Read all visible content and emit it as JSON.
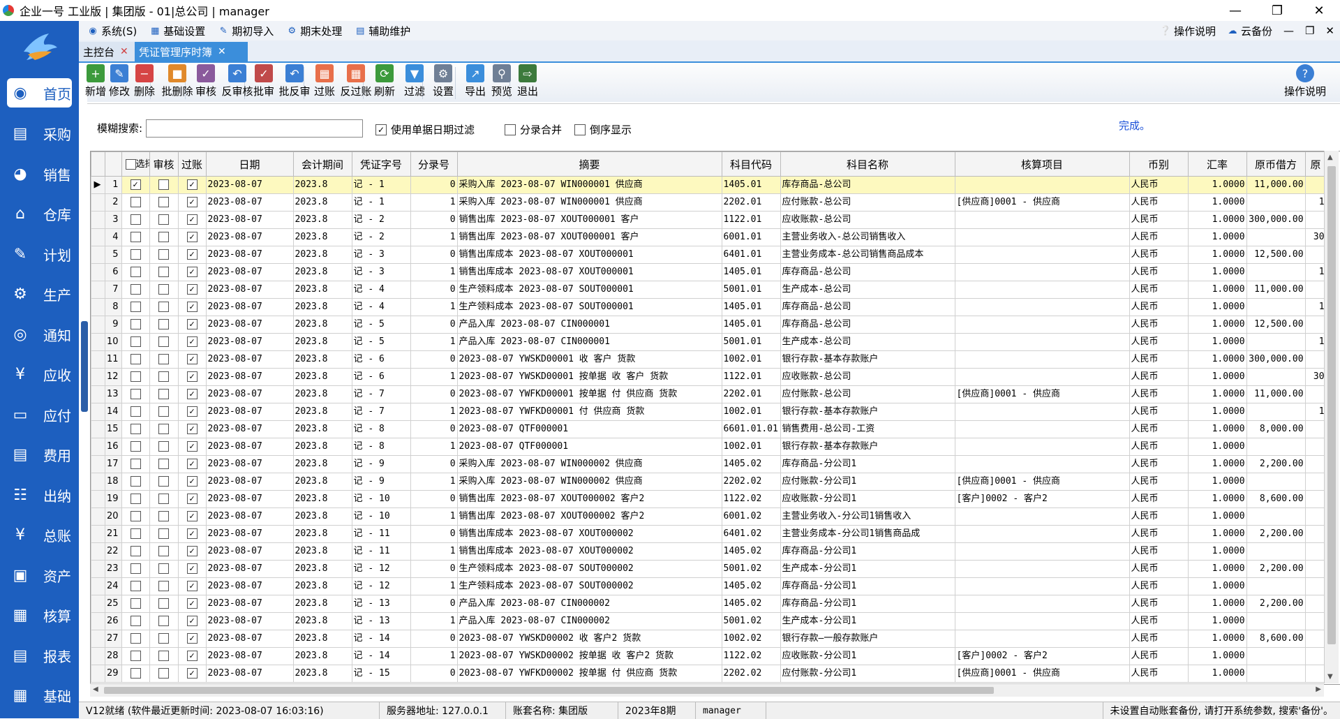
{
  "window": {
    "title": "企业一号 工业版 | 集团版 - 01|总公司 | manager"
  },
  "sidebar": {
    "items": [
      {
        "label": "首页",
        "icon": "compass-icon"
      },
      {
        "label": "采购",
        "icon": "purchase-icon"
      },
      {
        "label": "销售",
        "icon": "sales-chart-icon"
      },
      {
        "label": "仓库",
        "icon": "warehouse-icon"
      },
      {
        "label": "计划",
        "icon": "plan-icon"
      },
      {
        "label": "生产",
        "icon": "production-icon"
      },
      {
        "label": "通知",
        "icon": "notice-icon"
      },
      {
        "label": "应收",
        "icon": "receivable-icon"
      },
      {
        "label": "应付",
        "icon": "payable-icon"
      },
      {
        "label": "费用",
        "icon": "expense-icon"
      },
      {
        "label": "出纳",
        "icon": "cashier-icon"
      },
      {
        "label": "总账",
        "icon": "ledger-icon"
      },
      {
        "label": "资产",
        "icon": "asset-icon"
      },
      {
        "label": "核算",
        "icon": "accounting-icon"
      },
      {
        "label": "报表",
        "icon": "report-icon"
      },
      {
        "label": "基础",
        "icon": "basic-grid-icon"
      }
    ]
  },
  "menubar": {
    "items": [
      "系统(S)",
      "基础设置",
      "期初导入",
      "期末处理",
      "辅助维护"
    ],
    "help": "操作说明",
    "cloud": "云备份"
  },
  "tabs": [
    {
      "label": "主控台"
    },
    {
      "label": "凭证管理序时簿"
    }
  ],
  "toolbar": {
    "buttons": [
      {
        "label": "新增",
        "color": "#3c9a3c"
      },
      {
        "label": "修改",
        "color": "#3b7fd4"
      },
      {
        "label": "删除",
        "color": "#d64545"
      },
      {
        "label": "批删除",
        "color": "#e0892b"
      },
      {
        "label": "审核",
        "color": "#8a5a9c"
      },
      {
        "label": "反审核",
        "color": "#3b7fd4"
      },
      {
        "label": "批审",
        "color": "#c04a4a"
      },
      {
        "label": "批反审",
        "color": "#3b7fd4"
      },
      {
        "label": "过账",
        "color": "#e86f4a"
      },
      {
        "label": "反过账",
        "color": "#e86f4a"
      },
      {
        "label": "刷新",
        "color": "#3c9a3c"
      },
      {
        "label": "过滤",
        "color": "#3b8edb"
      },
      {
        "label": "设置",
        "color": "#6f7f95"
      },
      {
        "label": "导出",
        "color": "#3b8edb"
      },
      {
        "label": "预览",
        "color": "#6f7f95"
      },
      {
        "label": "退出",
        "color": "#3c7a3c"
      }
    ],
    "help": "操作说明"
  },
  "filter": {
    "search_label": "模糊搜索:",
    "search_value": "",
    "use_date_filter": "使用单据日期过滤",
    "merge_entries": "分录合并",
    "reverse_display": "倒序显示",
    "status": "完成。"
  },
  "table": {
    "headers": [
      "选择",
      "审核",
      "过账",
      "日期",
      "会计期间",
      "凭证字号",
      "分录号",
      "摘要",
      "科目代码",
      "科目名称",
      "核算项目",
      "币别",
      "汇率",
      "原币借方",
      "原"
    ],
    "rows": [
      {
        "n": "1",
        "date": "2023-08-07",
        "period": "2023.8",
        "voucher": "记 - 1",
        "entry": "0",
        "summary": "采购入库 2023-08-07 WIN000001   供应商",
        "code": "1405.01",
        "account": "库存商品-总公司",
        "item": "",
        "cur": "人民币",
        "rate": "1.0000",
        "debit": "11,000.00",
        "extra": ""
      },
      {
        "n": "2",
        "date": "2023-08-07",
        "period": "2023.8",
        "voucher": "记 - 1",
        "entry": "1",
        "summary": "采购入库 2023-08-07 WIN000001   供应商",
        "code": "2202.01",
        "account": "应付账款-总公司",
        "item": "[供应商]0001 - 供应商",
        "cur": "人民币",
        "rate": "1.0000",
        "debit": "",
        "extra": "1"
      },
      {
        "n": "3",
        "date": "2023-08-07",
        "period": "2023.8",
        "voucher": "记 - 2",
        "entry": "0",
        "summary": "销售出库 2023-08-07 XOUT000001   客户",
        "code": "1122.01",
        "account": "应收账款-总公司",
        "item": "",
        "cur": "人民币",
        "rate": "1.0000",
        "debit": "300,000.00",
        "extra": ""
      },
      {
        "n": "4",
        "date": "2023-08-07",
        "period": "2023.8",
        "voucher": "记 - 2",
        "entry": "1",
        "summary": "销售出库 2023-08-07 XOUT000001   客户",
        "code": "6001.01",
        "account": "主营业务收入-总公司销售收入",
        "item": "",
        "cur": "人民币",
        "rate": "1.0000",
        "debit": "",
        "extra": "30"
      },
      {
        "n": "5",
        "date": "2023-08-07",
        "period": "2023.8",
        "voucher": "记 - 3",
        "entry": "0",
        "summary": "销售出库成本 2023-08-07 XOUT000001",
        "code": "6401.01",
        "account": "主营业务成本-总公司销售商品成本",
        "item": "",
        "cur": "人民币",
        "rate": "1.0000",
        "debit": "12,500.00",
        "extra": ""
      },
      {
        "n": "6",
        "date": "2023-08-07",
        "period": "2023.8",
        "voucher": "记 - 3",
        "entry": "1",
        "summary": "销售出库成本 2023-08-07 XOUT000001",
        "code": "1405.01",
        "account": "库存商品-总公司",
        "item": "",
        "cur": "人民币",
        "rate": "1.0000",
        "debit": "",
        "extra": "1"
      },
      {
        "n": "7",
        "date": "2023-08-07",
        "period": "2023.8",
        "voucher": "记 - 4",
        "entry": "0",
        "summary": "生产领料成本 2023-08-07 SOUT000001",
        "code": "5001.01",
        "account": "生产成本-总公司",
        "item": "",
        "cur": "人民币",
        "rate": "1.0000",
        "debit": "11,000.00",
        "extra": ""
      },
      {
        "n": "8",
        "date": "2023-08-07",
        "period": "2023.8",
        "voucher": "记 - 4",
        "entry": "1",
        "summary": "生产领料成本 2023-08-07 SOUT000001",
        "code": "1405.01",
        "account": "库存商品-总公司",
        "item": "",
        "cur": "人民币",
        "rate": "1.0000",
        "debit": "",
        "extra": "1"
      },
      {
        "n": "9",
        "date": "2023-08-07",
        "period": "2023.8",
        "voucher": "记 - 5",
        "entry": "0",
        "summary": "产品入库 2023-08-07 CIN000001",
        "code": "1405.01",
        "account": "库存商品-总公司",
        "item": "",
        "cur": "人民币",
        "rate": "1.0000",
        "debit": "12,500.00",
        "extra": ""
      },
      {
        "n": "10",
        "date": "2023-08-07",
        "period": "2023.8",
        "voucher": "记 - 5",
        "entry": "1",
        "summary": "产品入库 2023-08-07 CIN000001",
        "code": "5001.01",
        "account": "生产成本-总公司",
        "item": "",
        "cur": "人民币",
        "rate": "1.0000",
        "debit": "",
        "extra": "1"
      },
      {
        "n": "11",
        "date": "2023-08-07",
        "period": "2023.8",
        "voucher": "记 - 6",
        "entry": "0",
        "summary": "2023-08-07 YWSKD00001 收 客户 货款",
        "code": "1002.01",
        "account": "银行存款-基本存款账户",
        "item": "",
        "cur": "人民币",
        "rate": "1.0000",
        "debit": "300,000.00",
        "extra": ""
      },
      {
        "n": "12",
        "date": "2023-08-07",
        "period": "2023.8",
        "voucher": "记 - 6",
        "entry": "1",
        "summary": "2023-08-07 YWSKD00001 按单据 收 客户 货款",
        "code": "1122.01",
        "account": "应收账款-总公司",
        "item": "",
        "cur": "人民币",
        "rate": "1.0000",
        "debit": "",
        "extra": "30"
      },
      {
        "n": "13",
        "date": "2023-08-07",
        "period": "2023.8",
        "voucher": "记 - 7",
        "entry": "0",
        "summary": "2023-08-07 YWFKD00001 按单据 付 供应商 货款",
        "code": "2202.01",
        "account": "应付账款-总公司",
        "item": "[供应商]0001 - 供应商",
        "cur": "人民币",
        "rate": "1.0000",
        "debit": "11,000.00",
        "extra": ""
      },
      {
        "n": "14",
        "date": "2023-08-07",
        "period": "2023.8",
        "voucher": "记 - 7",
        "entry": "1",
        "summary": "2023-08-07 YWFKD00001  付 供应商 货款",
        "code": "1002.01",
        "account": "银行存款-基本存款账户",
        "item": "",
        "cur": "人民币",
        "rate": "1.0000",
        "debit": "",
        "extra": "1"
      },
      {
        "n": "15",
        "date": "2023-08-07",
        "period": "2023.8",
        "voucher": "记 - 8",
        "entry": "0",
        "summary": "2023-08-07 QTF000001",
        "code": "6601.01.01",
        "account": "销售费用-总公司-工资",
        "item": "",
        "cur": "人民币",
        "rate": "1.0000",
        "debit": "8,000.00",
        "extra": ""
      },
      {
        "n": "16",
        "date": "2023-08-07",
        "period": "2023.8",
        "voucher": "记 - 8",
        "entry": "1",
        "summary": "2023-08-07 QTF000001",
        "code": "1002.01",
        "account": "银行存款-基本存款账户",
        "item": "",
        "cur": "人民币",
        "rate": "1.0000",
        "debit": "",
        "extra": ""
      },
      {
        "n": "17",
        "date": "2023-08-07",
        "period": "2023.8",
        "voucher": "记 - 9",
        "entry": "0",
        "summary": "采购入库 2023-08-07 WIN000002   供应商",
        "code": "1405.02",
        "account": "库存商品-分公司1",
        "item": "",
        "cur": "人民币",
        "rate": "1.0000",
        "debit": "2,200.00",
        "extra": ""
      },
      {
        "n": "18",
        "date": "2023-08-07",
        "period": "2023.8",
        "voucher": "记 - 9",
        "entry": "1",
        "summary": "采购入库 2023-08-07 WIN000002   供应商",
        "code": "2202.02",
        "account": "应付账款-分公司1",
        "item": "[供应商]0001 - 供应商",
        "cur": "人民币",
        "rate": "1.0000",
        "debit": "",
        "extra": ""
      },
      {
        "n": "19",
        "date": "2023-08-07",
        "period": "2023.8",
        "voucher": "记 - 10",
        "entry": "0",
        "summary": "销售出库 2023-08-07 XOUT000002   客户2",
        "code": "1122.02",
        "account": "应收账款-分公司1",
        "item": "[客户]0002 - 客户2",
        "cur": "人民币",
        "rate": "1.0000",
        "debit": "8,600.00",
        "extra": ""
      },
      {
        "n": "20",
        "date": "2023-08-07",
        "period": "2023.8",
        "voucher": "记 - 10",
        "entry": "1",
        "summary": "销售出库 2023-08-07 XOUT000002   客户2",
        "code": "6001.02",
        "account": "主营业务收入-分公司1销售收入",
        "item": "",
        "cur": "人民币",
        "rate": "1.0000",
        "debit": "",
        "extra": ""
      },
      {
        "n": "21",
        "date": "2023-08-07",
        "period": "2023.8",
        "voucher": "记 - 11",
        "entry": "0",
        "summary": "销售出库成本 2023-08-07 XOUT000002",
        "code": "6401.02",
        "account": "主营业务成本-分公司1销售商品成",
        "item": "",
        "cur": "人民币",
        "rate": "1.0000",
        "debit": "2,200.00",
        "extra": ""
      },
      {
        "n": "22",
        "date": "2023-08-07",
        "period": "2023.8",
        "voucher": "记 - 11",
        "entry": "1",
        "summary": "销售出库成本 2023-08-07 XOUT000002",
        "code": "1405.02",
        "account": "库存商品-分公司1",
        "item": "",
        "cur": "人民币",
        "rate": "1.0000",
        "debit": "",
        "extra": ""
      },
      {
        "n": "23",
        "date": "2023-08-07",
        "period": "2023.8",
        "voucher": "记 - 12",
        "entry": "0",
        "summary": "生产领料成本 2023-08-07 SOUT000002",
        "code": "5001.02",
        "account": "生产成本-分公司1",
        "item": "",
        "cur": "人民币",
        "rate": "1.0000",
        "debit": "2,200.00",
        "extra": ""
      },
      {
        "n": "24",
        "date": "2023-08-07",
        "period": "2023.8",
        "voucher": "记 - 12",
        "entry": "1",
        "summary": "生产领料成本 2023-08-07 SOUT000002",
        "code": "1405.02",
        "account": "库存商品-分公司1",
        "item": "",
        "cur": "人民币",
        "rate": "1.0000",
        "debit": "",
        "extra": ""
      },
      {
        "n": "25",
        "date": "2023-08-07",
        "period": "2023.8",
        "voucher": "记 - 13",
        "entry": "0",
        "summary": "产品入库 2023-08-07 CIN000002",
        "code": "1405.02",
        "account": "库存商品-分公司1",
        "item": "",
        "cur": "人民币",
        "rate": "1.0000",
        "debit": "2,200.00",
        "extra": ""
      },
      {
        "n": "26",
        "date": "2023-08-07",
        "period": "2023.8",
        "voucher": "记 - 13",
        "entry": "1",
        "summary": "产品入库 2023-08-07 CIN000002",
        "code": "5001.02",
        "account": "生产成本-分公司1",
        "item": "",
        "cur": "人民币",
        "rate": "1.0000",
        "debit": "",
        "extra": ""
      },
      {
        "n": "27",
        "date": "2023-08-07",
        "period": "2023.8",
        "voucher": "记 - 14",
        "entry": "0",
        "summary": "2023-08-07 YWSKD00002 收 客户2 货款",
        "code": "1002.02",
        "account": "银行存款—一般存款账户",
        "item": "",
        "cur": "人民币",
        "rate": "1.0000",
        "debit": "8,600.00",
        "extra": ""
      },
      {
        "n": "28",
        "date": "2023-08-07",
        "period": "2023.8",
        "voucher": "记 - 14",
        "entry": "1",
        "summary": "2023-08-07 YWSKD00002 按单据 收 客户2 货款",
        "code": "1122.02",
        "account": "应收账款-分公司1",
        "item": "[客户]0002 - 客户2",
        "cur": "人民币",
        "rate": "1.0000",
        "debit": "",
        "extra": ""
      },
      {
        "n": "29",
        "date": "2023-08-07",
        "period": "2023.8",
        "voucher": "记 - 15",
        "entry": "0",
        "summary": "2023-08-07 YWFKD00002 按单据 付 供应商 货款",
        "code": "2202.02",
        "account": "应付账款-分公司1",
        "item": "[供应商]0001 - 供应商",
        "cur": "人民币",
        "rate": "1.0000",
        "debit": "",
        "extra": ""
      }
    ]
  },
  "statusbar": {
    "ready": "V12就绪 (软件最近更新时间: 2023-08-07 16:03:16)",
    "server": "服务器地址: 127.0.0.1",
    "account_set": "账套名称: 集团版",
    "period": "2023年8期",
    "user": "manager",
    "backup_notice": "未设置自动账套备份, 请打开系统参数, 搜索'备份'。"
  }
}
